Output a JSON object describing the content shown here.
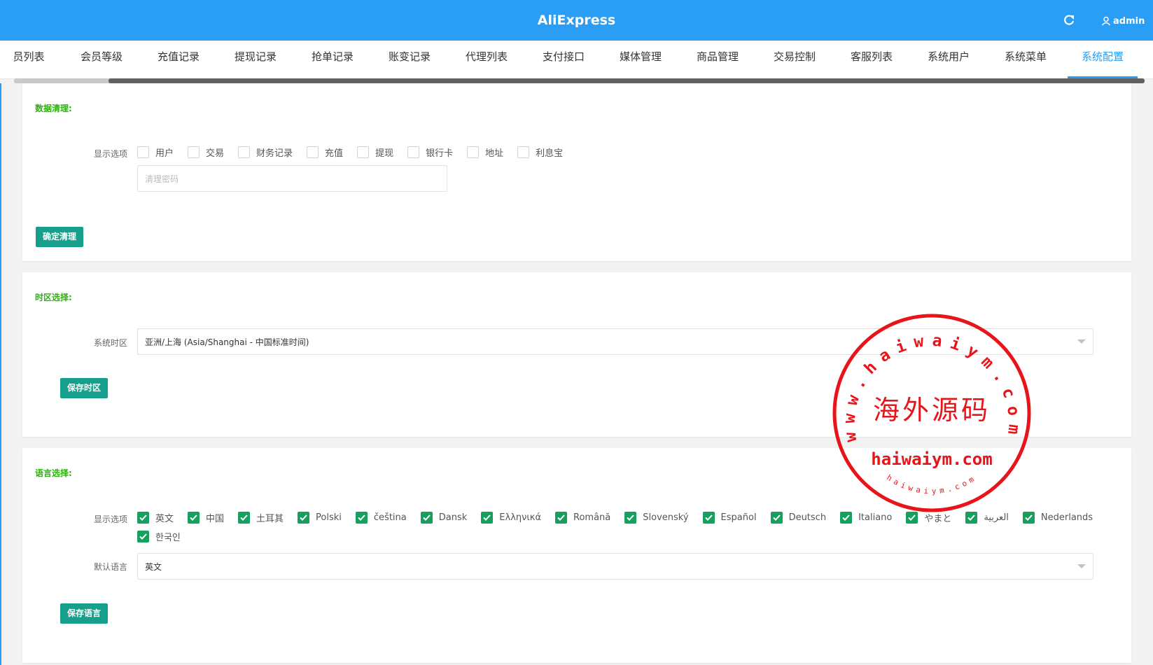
{
  "app": {
    "title": "AliExpress",
    "user": "admin"
  },
  "tabs": [
    {
      "label": "员列表"
    },
    {
      "label": "会员等级"
    },
    {
      "label": "充值记录"
    },
    {
      "label": "提现记录"
    },
    {
      "label": "抢单记录"
    },
    {
      "label": "账变记录"
    },
    {
      "label": "代理列表"
    },
    {
      "label": "支付接口"
    },
    {
      "label": "媒体管理"
    },
    {
      "label": "商品管理"
    },
    {
      "label": "交易控制"
    },
    {
      "label": "客服列表"
    },
    {
      "label": "系统用户"
    },
    {
      "label": "系统菜单"
    },
    {
      "label": "系统配置",
      "active": true
    }
  ],
  "data_clear": {
    "title": "数据清理:",
    "options_label": "显示选项",
    "options": [
      {
        "label": "用户",
        "checked": false
      },
      {
        "label": "交易",
        "checked": false
      },
      {
        "label": "财务记录",
        "checked": false
      },
      {
        "label": "充值",
        "checked": false
      },
      {
        "label": "提现",
        "checked": false
      },
      {
        "label": "银行卡",
        "checked": false
      },
      {
        "label": "地址",
        "checked": false
      },
      {
        "label": "利息宝",
        "checked": false
      }
    ],
    "password_placeholder": "清理密码",
    "confirm_button": "确定清理"
  },
  "timezone": {
    "title": "时区选择:",
    "label": "系统时区",
    "value": "亚洲/上海 (Asia/Shanghai - 中国标准时间)",
    "save_button": "保存时区"
  },
  "language": {
    "title": "语言选择:",
    "options_label": "显示选项",
    "options": [
      {
        "label": "英文",
        "checked": true
      },
      {
        "label": "中国",
        "checked": true
      },
      {
        "label": "土耳其",
        "checked": true
      },
      {
        "label": "Polski",
        "checked": true
      },
      {
        "label": "čeština",
        "checked": true
      },
      {
        "label": "Dansk",
        "checked": true
      },
      {
        "label": "Ελληνικά",
        "checked": true
      },
      {
        "label": "Română",
        "checked": true
      },
      {
        "label": "Slovenský",
        "checked": true
      },
      {
        "label": "Español",
        "checked": true
      },
      {
        "label": "Deutsch",
        "checked": true
      },
      {
        "label": "Italiano",
        "checked": true
      },
      {
        "label": "やまと",
        "checked": true
      },
      {
        "label": "العربية",
        "checked": true
      },
      {
        "label": "Nederlands",
        "checked": true
      },
      {
        "label": "한국인",
        "checked": true
      }
    ],
    "default_label": "默认语言",
    "default_value": "英文",
    "save_button": "保存语言"
  },
  "watermark": {
    "outer_text": "www.haiwaiym.com",
    "center_text": "海外源码",
    "bottom_text": "haiwaiym.com",
    "small_text": "haiwaiym.com",
    "color": "#e8141a"
  },
  "colors": {
    "primary": "#2a9df4",
    "button": "#16a08b",
    "checkbox": "#16a05d",
    "section_title": "#2bb30b"
  }
}
